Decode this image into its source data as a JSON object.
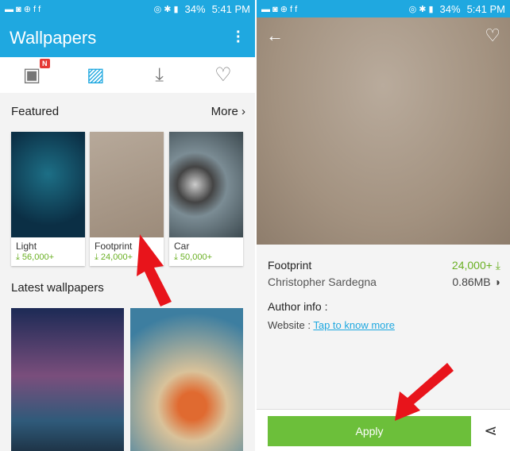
{
  "status": {
    "time": "5:41 PM",
    "battery": "34%"
  },
  "left": {
    "app_title": "Wallpapers",
    "tabs": [
      {
        "icon": "featured-book-icon",
        "badge": "N"
      },
      {
        "icon": "gallery-icon",
        "active": true
      },
      {
        "icon": "download-icon"
      },
      {
        "icon": "heart-icon"
      }
    ],
    "featured_label": "Featured",
    "more_label": "More",
    "cards": [
      {
        "name": "Light",
        "count": "56,000+"
      },
      {
        "name": "Footprint",
        "count": "24,000+"
      },
      {
        "name": "Car",
        "count": "50,000+"
      }
    ],
    "latest_label": "Latest wallpapers"
  },
  "right": {
    "name": "Footprint",
    "downloads": "24,000+",
    "author": "Christopher Sardegna",
    "size": "0.86MB",
    "author_info_label": "Author info :",
    "website_label": "Website :",
    "website_link": "Tap to know more",
    "apply_label": "Apply"
  },
  "colors": {
    "accent": "#1fa8e0",
    "green": "#6cbf3a",
    "arrow": "#e8141b"
  }
}
